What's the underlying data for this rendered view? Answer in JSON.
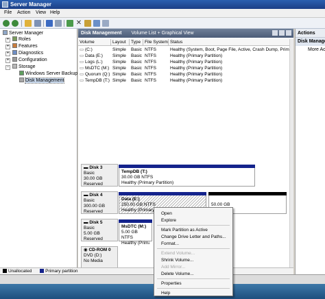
{
  "window": {
    "title": "Server Manager"
  },
  "menubar": [
    "File",
    "Action",
    "View",
    "Help"
  ],
  "toolbar": {
    "icons": [
      "back-arrow-icon",
      "forward-arrow-icon",
      "up-folder-icon",
      "console-tree-icon",
      "help-icon",
      "properties-icon",
      "delete-icon",
      "action-icon",
      "refresh-icon",
      "view-list-icon"
    ]
  },
  "tree": {
    "root": "Server Manager",
    "items": [
      "Roles",
      "Features",
      "Diagnostics",
      "Configuration",
      "Storage"
    ],
    "storage_children": [
      "Windows Server Backup",
      "Disk Management"
    ]
  },
  "main": {
    "pane_title": "Disk Management",
    "pane_subtitle": "Volume List + Graphical View",
    "columns": [
      "Volume",
      "Layout",
      "Type",
      "File System",
      "Status"
    ],
    "rows": [
      {
        "volume": "(C:)",
        "layout": "Simple",
        "type": "Basic",
        "fs": "NTFS",
        "status": "Healthy (System, Boot, Page File, Active, Crash Dump, Primary Pa"
      },
      {
        "volume": "Data (E:)",
        "layout": "Simple",
        "type": "Basic",
        "fs": "NTFS",
        "status": "Healthy (Primary Partition)"
      },
      {
        "volume": "Logs (L:)",
        "layout": "Simple",
        "type": "Basic",
        "fs": "NTFS",
        "status": "Healthy (Primary Partition)"
      },
      {
        "volume": "MsDTC (M:)",
        "layout": "Simple",
        "type": "Basic",
        "fs": "NTFS",
        "status": "Healthy (Primary Partition)"
      },
      {
        "volume": "Quorum (Q:)",
        "layout": "Simple",
        "type": "Basic",
        "fs": "NTFS",
        "status": "Healthy (Primary Partition)"
      },
      {
        "volume": "TempDB (T:)",
        "layout": "Simple",
        "type": "Basic",
        "fs": "NTFS",
        "status": "Healthy (Primary Partition)"
      }
    ]
  },
  "disks": [
    {
      "name": "Disk 3",
      "kind": "Basic",
      "size": "30.00 GB",
      "state": "Reserved",
      "partitions": [
        {
          "name": "TempDB (T:)",
          "size": "30.00 GB NTFS",
          "status": "Healthy (Primary Partition)"
        }
      ]
    },
    {
      "name": "Disk 4",
      "kind": "Basic",
      "size": "300.00 GB",
      "state": "Reserved",
      "partitions": [
        {
          "name": "Data (E:)",
          "size": "250.00 GB NTFS",
          "status": "Healthy (Primary Partition)"
        },
        {
          "name": "",
          "size": "50.00 GB",
          "status": ""
        }
      ]
    },
    {
      "name": "Disk 5",
      "kind": "Basic",
      "size": "5.00 GB",
      "state": "Reserved",
      "partitions": [
        {
          "name": "MsDTC (M:)",
          "size": "5.00 GB NTFS",
          "status": "Healthy (Primary Partition)"
        }
      ]
    },
    {
      "name": "CD-ROM 0",
      "kind": "DVD (D:)",
      "size": "",
      "state": "No Media",
      "partitions": []
    }
  ],
  "legend": [
    "Unallocated",
    "Primary partition"
  ],
  "actions": {
    "header": "Actions",
    "section": "Disk Manage",
    "more": "More Acti"
  },
  "context_menu": {
    "items": [
      {
        "label": "Open",
        "enabled": true
      },
      {
        "label": "Explore",
        "enabled": true
      },
      {
        "label": "Mark Partition as Active",
        "enabled": true
      },
      {
        "label": "Change Drive Letter and Paths...",
        "enabled": true
      },
      {
        "label": "Format...",
        "enabled": true
      },
      {
        "label": "Extend Volume...",
        "enabled": false
      },
      {
        "label": "Shrink Volume...",
        "enabled": true
      },
      {
        "label": "Add Mirror...",
        "enabled": false
      },
      {
        "label": "Delete Volume...",
        "enabled": true
      },
      {
        "label": "Properties",
        "enabled": true
      },
      {
        "label": "Help",
        "enabled": true
      }
    ]
  },
  "colors": {
    "primary_partition": "#14238c",
    "unallocated": "#000000",
    "title_bar": "#1c3f86",
    "pane_header": "#4c5c78"
  }
}
